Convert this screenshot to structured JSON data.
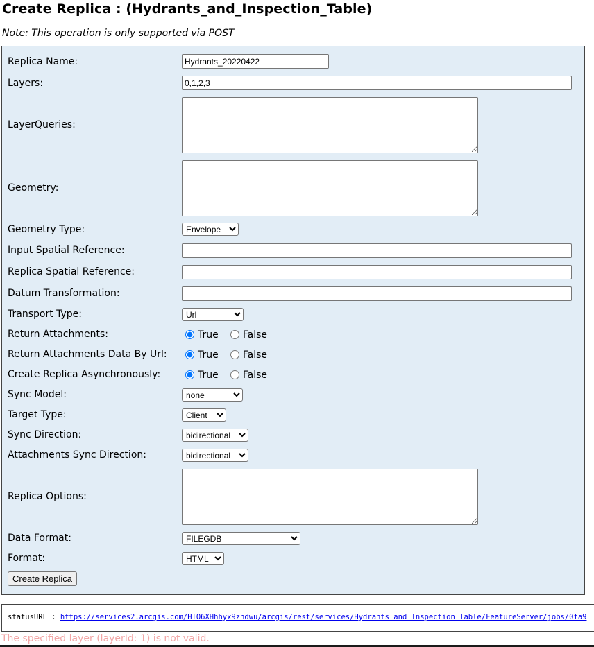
{
  "page": {
    "title": "Create Replica : (Hydrants_and_Inspection_Table)",
    "note": "Note: This operation is only supported via POST"
  },
  "form": {
    "replica_name": {
      "label": "Replica Name:",
      "value": "Hydrants_20220422"
    },
    "layers": {
      "label": "Layers:",
      "value": "0,1,2,3"
    },
    "layer_queries": {
      "label": "LayerQueries:",
      "value": ""
    },
    "geometry": {
      "label": "Geometry:",
      "value": ""
    },
    "geometry_type": {
      "label": "Geometry Type:",
      "selected": "Envelope"
    },
    "input_sr": {
      "label": "Input Spatial Reference:",
      "value": ""
    },
    "replica_sr": {
      "label": "Replica Spatial Reference:",
      "value": ""
    },
    "datum_transformation": {
      "label": "Datum Transformation:",
      "value": ""
    },
    "transport_type": {
      "label": "Transport Type:",
      "selected": "Url"
    },
    "return_attachments": {
      "label": "Return Attachments:",
      "true_label": "True",
      "false_label": "False"
    },
    "return_attachments_url": {
      "label": "Return Attachments Data By Url:",
      "true_label": "True",
      "false_label": "False"
    },
    "async": {
      "label": "Create Replica Asynchronously:",
      "true_label": "True",
      "false_label": "False"
    },
    "sync_model": {
      "label": "Sync Model:",
      "selected": "none"
    },
    "target_type": {
      "label": "Target Type:",
      "selected": "Client"
    },
    "sync_direction": {
      "label": "Sync Direction:",
      "selected": "bidirectional"
    },
    "attachments_sync_direction": {
      "label": "Attachments Sync Direction:",
      "selected": "bidirectional"
    },
    "replica_options": {
      "label": "Replica Options:",
      "value": ""
    },
    "data_format": {
      "label": "Data Format:",
      "selected": "FILEGDB"
    },
    "format": {
      "label": "Format:",
      "selected": "HTML"
    },
    "submit_label": "Create Replica"
  },
  "status": {
    "label": "statusURL :",
    "url": "https://services2.arcgis.com/HTO6XHhhyx9zhdwu/arcgis/rest/services/Hydrants_and_Inspection_Table/FeatureServer/jobs/0fa9"
  },
  "error": "The specified layer (layerId: 1) is not valid."
}
